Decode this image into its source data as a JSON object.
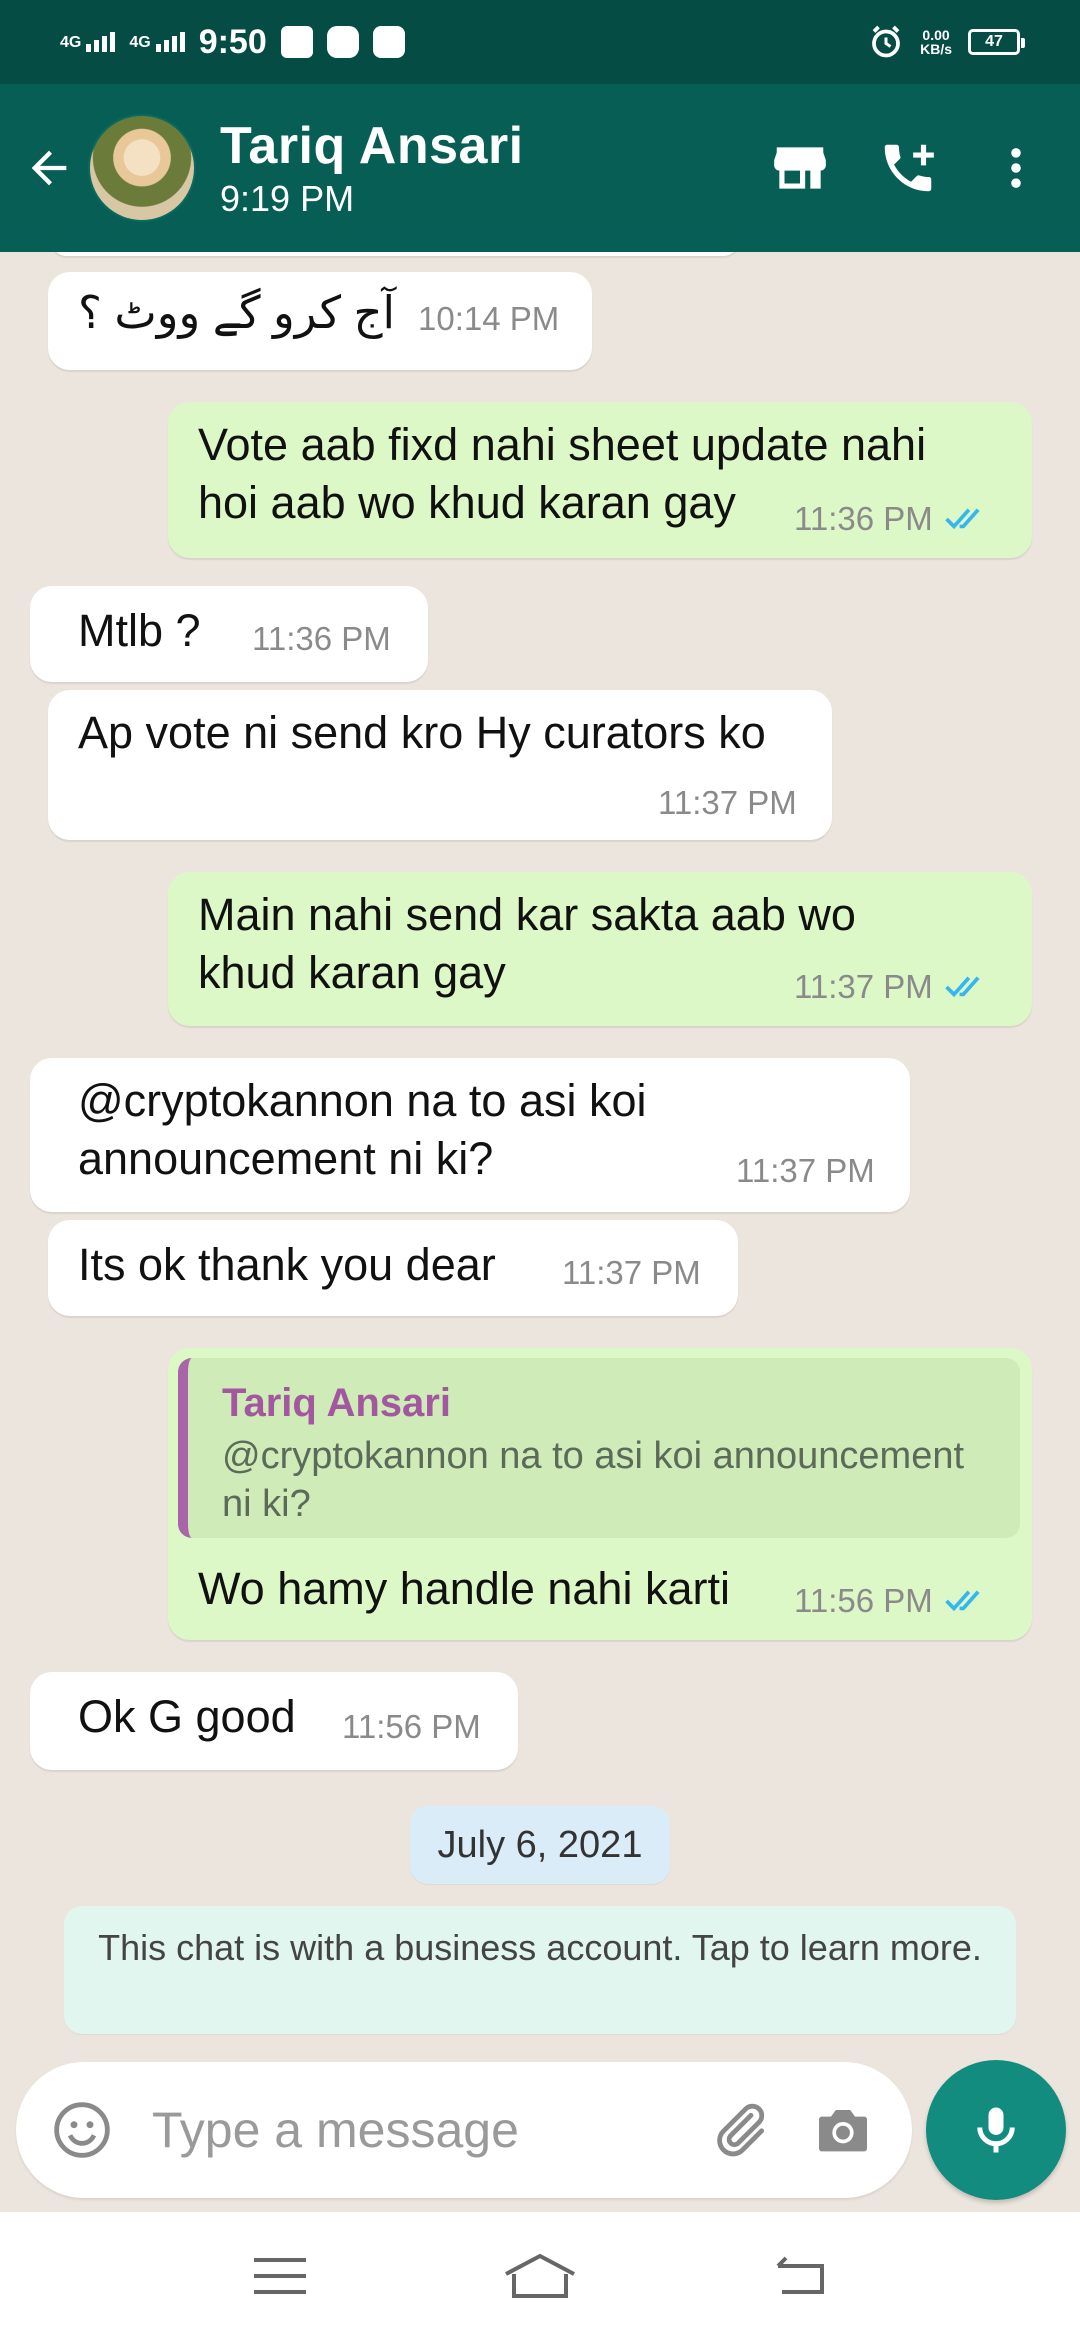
{
  "status_bar": {
    "network1": "4G",
    "network2": "4G",
    "time": "9:50",
    "speed_value": "0.00",
    "speed_unit": "KB/s",
    "battery": "47"
  },
  "header": {
    "name": "Tariq Ansari",
    "subtitle": "9:19 PM"
  },
  "messages": [
    {
      "dir": "in",
      "text": "آج کرو گے ووٹ ؟",
      "time": "10:14 PM"
    },
    {
      "dir": "out",
      "text": "Vote aab fixd nahi sheet update nahi hoi aab wo khud karan gay",
      "time": "11:36 PM"
    },
    {
      "dir": "in",
      "text": "Mtlb ?",
      "time": "11:36 PM"
    },
    {
      "dir": "in",
      "text": "Ap vote ni send kro Hy curators ko",
      "time": "11:37 PM"
    },
    {
      "dir": "out",
      "text": "Main nahi send kar sakta aab wo khud karan gay",
      "time": "11:37 PM"
    },
    {
      "dir": "in",
      "text": "@cryptokannon na to asi koi announcement ni ki?",
      "time": "11:37 PM"
    },
    {
      "dir": "in",
      "text": "Its ok thank you dear",
      "time": "11:37 PM"
    },
    {
      "dir": "out",
      "quote_author": "Tariq Ansari",
      "quote_text": "@cryptokannon na to asi koi announcement ni ki?",
      "text": "Wo hamy handle nahi karti",
      "time": "11:56 PM"
    },
    {
      "dir": "in",
      "text": "Ok G good",
      "time": "11:56 PM"
    }
  ],
  "date_chip": "July 6, 2021",
  "business_note": "This chat is with a business account. Tap to learn more.",
  "input": {
    "placeholder": "Type a message"
  },
  "icons": {
    "back": "arrow-left-icon",
    "store": "store-icon",
    "call": "add-call-icon",
    "menu": "more-vert-icon",
    "emoji": "emoji-icon",
    "attach": "paperclip-icon",
    "camera": "camera-icon",
    "mic": "mic-icon",
    "read": "double-check-icon"
  },
  "colors": {
    "header": "#075E54",
    "status_bar": "#054D44",
    "outgoing": "#DCF8C6",
    "incoming": "#FFFFFF",
    "ticks": "#34B7F1",
    "mic_button": "#128C7E"
  }
}
